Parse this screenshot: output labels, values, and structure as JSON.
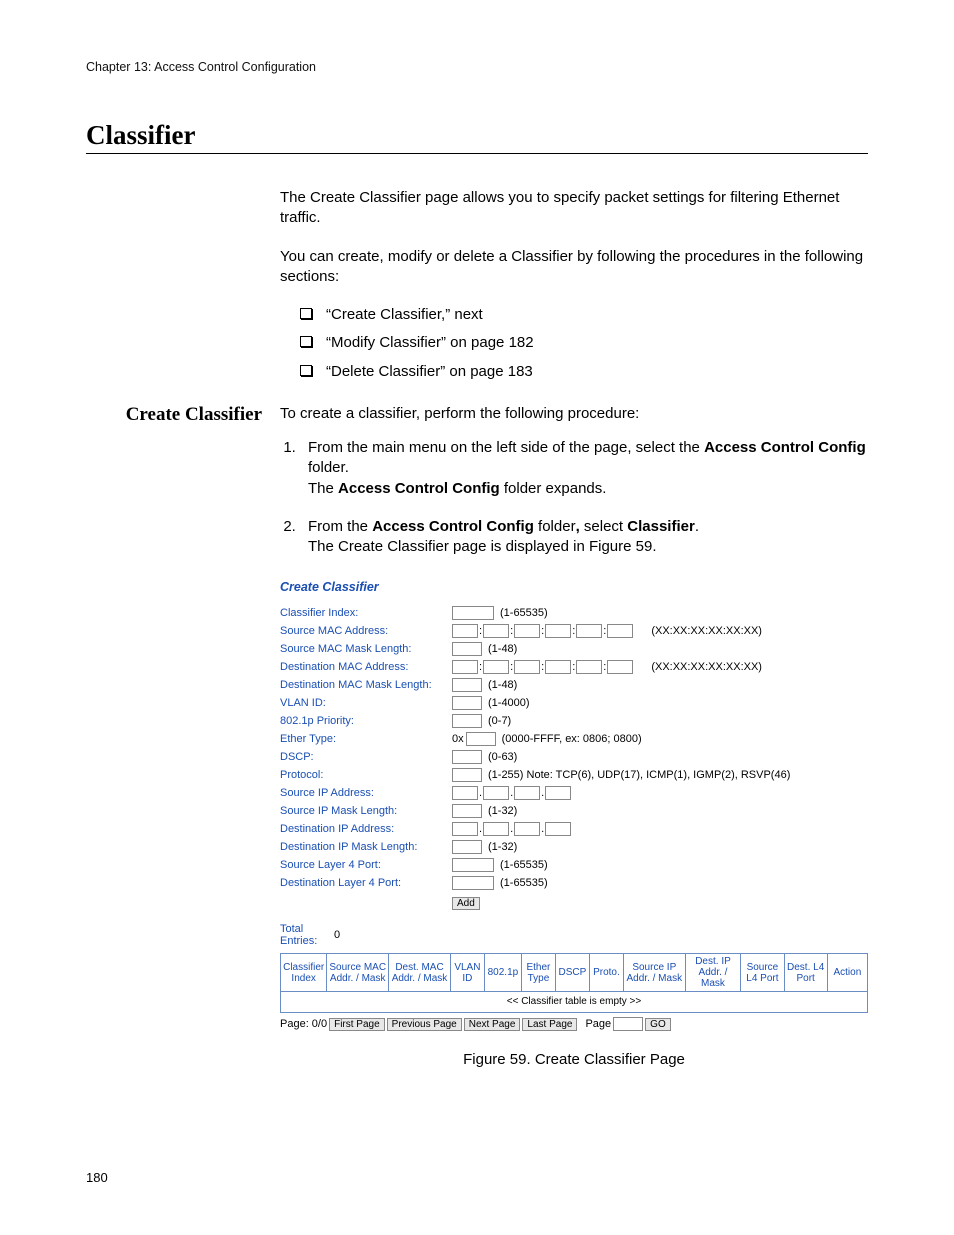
{
  "header": {
    "chapter": "Chapter 13: Access Control Configuration"
  },
  "title": "Classifier",
  "intro": {
    "p1": "The Create Classifier page allows you to specify packet settings for filtering Ethernet traffic.",
    "p2": "You can create, modify or delete a Classifier by following the procedures in the following sections:",
    "bullets": [
      "“Create Classifier,”  next",
      "“Modify Classifier” on page 182",
      "“Delete Classifier” on page 183"
    ]
  },
  "create": {
    "heading": "Create Classifier",
    "lead": "To create a classifier, perform the following procedure:",
    "step1": {
      "pre": "From the main menu on the left side of the page, select the ",
      "bold1": "Access Control Config",
      "mid1": " folder.",
      "line2a": "The ",
      "bold2": "Access Control Config",
      "line2b": " folder expands."
    },
    "step2": {
      "pre": "From the ",
      "bold1": "Access Control Config",
      "mid1": " folder",
      "boldcomma": ",",
      "mid2": " select ",
      "bold2": "Classifier",
      "end": ".",
      "line2": "The Create Classifier page is displayed in Figure 59."
    }
  },
  "panel": {
    "title": "Create Classifier",
    "fields": {
      "classifier_index": {
        "label": "Classifier Index:",
        "hint": "(1-65535)"
      },
      "src_mac": {
        "label": "Source MAC Address:",
        "hint": "(XX:XX:XX:XX:XX:XX)"
      },
      "src_mac_mask": {
        "label": "Source MAC Mask Length:",
        "hint": "(1-48)"
      },
      "dst_mac": {
        "label": "Destination MAC Address:",
        "hint": "(XX:XX:XX:XX:XX:XX)"
      },
      "dst_mac_mask": {
        "label": "Destination MAC Mask Length:",
        "hint": "(1-48)"
      },
      "vlan_id": {
        "label": "VLAN ID:",
        "hint": "(1-4000)"
      },
      "p8021": {
        "label": "802.1p Priority:",
        "hint": "(0-7)"
      },
      "ether_type": {
        "label": "Ether Type:",
        "prefix": "0x",
        "hint": "(0000-FFFF, ex: 0806; 0800)"
      },
      "dscp": {
        "label": "DSCP:",
        "hint": "(0-63)"
      },
      "protocol": {
        "label": "Protocol:",
        "hint": "(1-255) Note: TCP(6), UDP(17), ICMP(1), IGMP(2), RSVP(46)"
      },
      "src_ip": {
        "label": "Source IP Address:"
      },
      "src_ip_mask": {
        "label": "Source IP Mask Length:",
        "hint": "(1-32)"
      },
      "dst_ip": {
        "label": "Destination IP Address:"
      },
      "dst_ip_mask": {
        "label": "Destination IP Mask Length:",
        "hint": "(1-32)"
      },
      "src_l4": {
        "label": "Source Layer 4 Port:",
        "hint": "(1-65535)"
      },
      "dst_l4": {
        "label": "Destination Layer 4 Port:",
        "hint": "(1-65535)"
      }
    },
    "add_button": "Add",
    "totals": {
      "label": "Total Entries:",
      "value": "0"
    },
    "columns": [
      "Classifier Index",
      "Source MAC Addr. / Mask",
      "Dest. MAC Addr. / Mask",
      "VLAN ID",
      "802.1p",
      "Ether Type",
      "DSCP",
      "Proto.",
      "Source IP Addr. / Mask",
      "Dest. IP Addr. / Mask",
      "Source L4 Port",
      "Dest. L4 Port",
      "Action"
    ],
    "empty_row": "<< Classifier table is empty >>",
    "pager": {
      "status": "Page: 0/0",
      "first": "First Page",
      "prev": "Previous Page",
      "next": "Next Page",
      "last": "Last Page",
      "page_label": "Page",
      "go": "GO"
    }
  },
  "caption": "Figure 59. Create Classifier Page",
  "page_number": "180"
}
